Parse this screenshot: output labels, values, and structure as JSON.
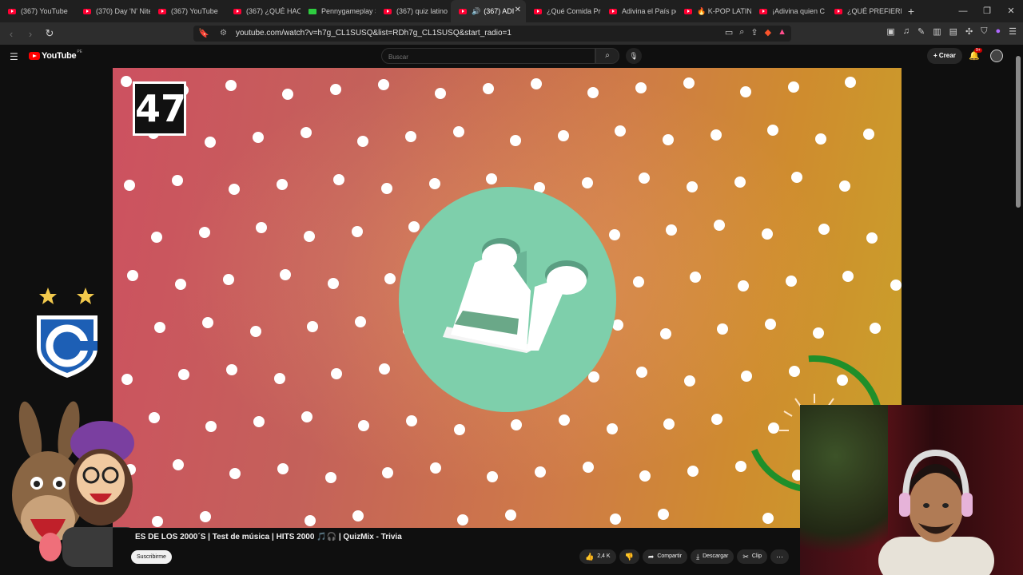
{
  "tabs": [
    {
      "label": "(367) YouTube",
      "favicon": "youtube-icon"
    },
    {
      "label": "(370) Day 'N' Nite",
      "favicon": "youtube-icon"
    },
    {
      "label": "(367) YouTube",
      "favicon": "youtube-icon"
    },
    {
      "label": "(367) ¿QUÉ HACE",
      "favicon": "youtube-icon"
    },
    {
      "label": "Pennygameplay S",
      "favicon": "kick-icon"
    },
    {
      "label": "(367) quiz latino",
      "favicon": "youtube-icon"
    },
    {
      "label": "(367) ADI",
      "favicon": "youtube-icon",
      "active": true,
      "audio": true
    },
    {
      "label": "¿Qué Comida Pre",
      "favicon": "youtube-icon"
    },
    {
      "label": "Adivina el País po",
      "favicon": "youtube-icon"
    },
    {
      "label": "🔥 K-POP LATIN",
      "favicon": "youtube-icon"
    },
    {
      "label": "¡Adivina quien C",
      "favicon": "youtube-icon"
    },
    {
      "label": "¿QUÉ PREFIERES",
      "favicon": "youtube-icon"
    }
  ],
  "address": {
    "url": "youtube.com/watch?v=h7g_CL1SUSQ&list=RDh7g_CL1SUSQ&start_radio=1"
  },
  "youtube": {
    "logo_text": "YouTube",
    "country": "PE",
    "search_placeholder": "Buscar",
    "create_label": "Crear",
    "notif_count": "9+"
  },
  "player": {
    "countdown": "47"
  },
  "video": {
    "title": "ES DE LOS 2000´S | Test de música | HITS 2000 🎵🎧 | QuizMix - Trivia",
    "subscribe_label": "Suscribirme",
    "likes": "2,4 K",
    "share_label": "Compartir",
    "download_label": "Descargar",
    "clip_label": "Clip"
  },
  "colors": {
    "accent": "#ff0000",
    "music_circle": "#7ecfab",
    "timer_ring": "#2fae33"
  }
}
